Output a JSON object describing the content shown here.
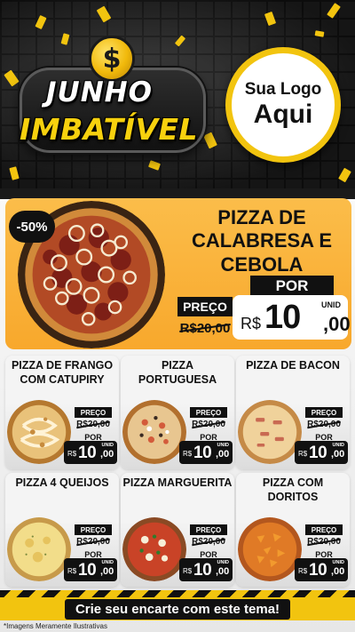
{
  "header": {
    "coin_symbol": "$",
    "title_line1": "JUNHO",
    "title_line2": "IMBATÍVEL",
    "brand_placeholder_line1": "Sua Logo",
    "brand_placeholder_line2": "Aqui"
  },
  "featured": {
    "discount": "-50%",
    "name": "PIZZA DE CALABRESA E CEBOLA",
    "preco_label": "PREÇO",
    "old_price": "R$20,00",
    "por_label": "POR",
    "unid_label": "UNID",
    "currency": "R$",
    "price_int": "10",
    "price_cents": ",00"
  },
  "products": [
    {
      "name": "PIZZA DE FRANGO COM CATUPIRY",
      "preco_label": "PREÇO",
      "old_price": "R$20,00",
      "por_label": "POR",
      "unid_label": "UNID",
      "currency": "R$",
      "price_int": "10",
      "price_cents": ",00"
    },
    {
      "name": "PIZZA PORTUGUESA",
      "preco_label": "PREÇO",
      "old_price": "R$20,00",
      "por_label": "POR",
      "unid_label": "UNID",
      "currency": "R$",
      "price_int": "10",
      "price_cents": ",00"
    },
    {
      "name": "PIZZA DE BACON",
      "preco_label": "PREÇO",
      "old_price": "R$20,00",
      "por_label": "POR",
      "unid_label": "UNID",
      "currency": "R$",
      "price_int": "10",
      "price_cents": ",00"
    },
    {
      "name": "PIZZA 4 QUEIJOS",
      "preco_label": "PREÇO",
      "old_price": "R$20,00",
      "por_label": "POR",
      "unid_label": "UNID",
      "currency": "R$",
      "price_int": "10",
      "price_cents": ",00"
    },
    {
      "name": "PIZZA MARGUERITA",
      "preco_label": "PREÇO",
      "old_price": "R$20,00",
      "por_label": "POR",
      "unid_label": "UNID",
      "currency": "R$",
      "price_int": "10",
      "price_cents": ",00"
    },
    {
      "name": "PIZZA COM DORITOS",
      "preco_label": "PREÇO",
      "old_price": "R$20,00",
      "por_label": "POR",
      "unid_label": "UNID",
      "currency": "R$",
      "price_int": "10",
      "price_cents": ",00"
    }
  ],
  "footer": {
    "cta": "Crie seu encarte com este tema!",
    "disclaimer": "*Imagens Meramente Ilustrativas"
  },
  "colors": {
    "accent_yellow": "#f2c40f",
    "feature_orange": "#f9ae33",
    "dark": "#111111"
  }
}
